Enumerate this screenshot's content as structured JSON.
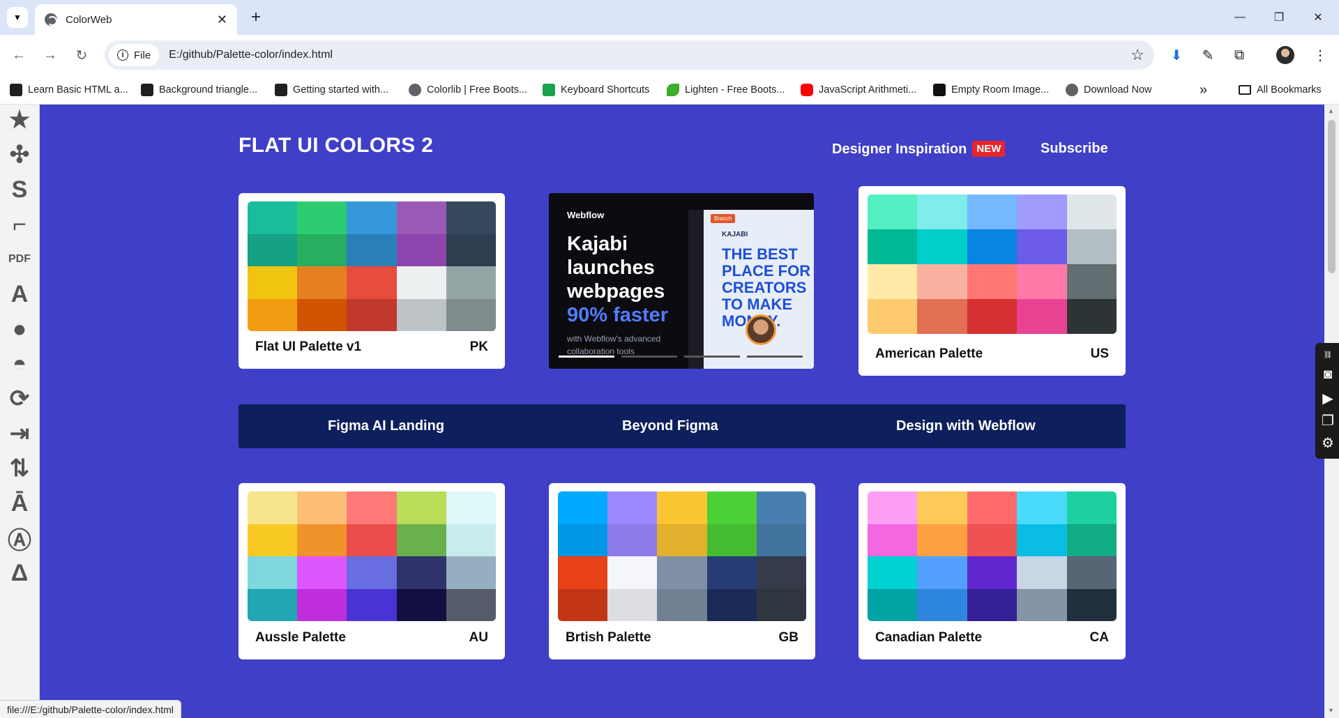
{
  "browser": {
    "tab_title": "ColorWeb",
    "tab_close": "✕",
    "new_tab": "+",
    "url_chip": "File",
    "url": "E:/github/Palette-color/index.html",
    "window_controls": {
      "minimize": "—",
      "restore": "❐",
      "close": "✕"
    }
  },
  "bookmarks": [
    {
      "label": "Learn Basic HTML a...",
      "icon": "code-icon",
      "color": "#1f1f1f"
    },
    {
      "label": "Background triangle...",
      "icon": "w-icon",
      "color": "#1f1f1f"
    },
    {
      "label": "Getting started with...",
      "icon": "m-icon",
      "color": "#1f1f1f"
    },
    {
      "label": "Colorlib | Free Boots...",
      "icon": "globe-icon",
      "color": "#5f6368"
    },
    {
      "label": "Keyboard Shortcuts",
      "icon": "w-check-icon",
      "color": "#17a34a"
    },
    {
      "label": "Lighten - Free Boots...",
      "icon": "leaf-icon",
      "color": "#3fae2a"
    },
    {
      "label": "JavaScript Arithmeti...",
      "icon": "youtube-icon",
      "color": "#ff0000"
    },
    {
      "label": "Empty Room Image...",
      "icon": "square-icon",
      "color": "#111111"
    },
    {
      "label": "Download Now",
      "icon": "globe-icon",
      "color": "#5f6368"
    }
  ],
  "bookmarks_more": "»",
  "all_bookmarks": "All Bookmarks",
  "page": {
    "background": "#3f3fc8",
    "brand": "FLAT UI COLORS 2",
    "nav": {
      "inspiration": "Designer Inspiration",
      "badge": "NEW",
      "subscribe": "Subscribe"
    },
    "strip": {
      "link1": "Figma AI Landing",
      "link2": "Beyond Figma",
      "link3": "Design with Webflow"
    },
    "ad": {
      "logo": "Webflow",
      "headline_1": "Kajabi launches webpages",
      "headline_2": "90% faster",
      "sub": "with Webflow's advanced collaboration tools",
      "panel_brand": "KAJABI",
      "panel_branch": "Branch",
      "panel_text": "THE BEST PLACE FOR CREATORS TO MAKE MONEY."
    },
    "palettes": [
      {
        "name": "Flat UI Palette v1",
        "code": "PK",
        "colors": [
          "#1abc9c",
          "#2ecc71",
          "#3498db",
          "#9b59b6",
          "#34495e",
          "#16a085",
          "#27ae60",
          "#2980b9",
          "#8e44ad",
          "#2c3e50",
          "#f1c40f",
          "#e67e22",
          "#e74c3c",
          "#ecf0f1",
          "#95a5a6",
          "#f39c12",
          "#d35400",
          "#c0392b",
          "#bdc3c7",
          "#7f8c8d"
        ]
      },
      {
        "name": "American Palette",
        "code": "US",
        "colors": [
          "#55efc4",
          "#81ecec",
          "#74b9ff",
          "#a29bfe",
          "#dfe6e9",
          "#00b894",
          "#00cec9",
          "#0984e3",
          "#6c5ce7",
          "#b2bec3",
          "#ffeaa7",
          "#fab1a0",
          "#ff7675",
          "#fd79a8",
          "#636e72",
          "#fdcb6e",
          "#e17055",
          "#d63031",
          "#e84393",
          "#2d3436"
        ]
      },
      {
        "name": "Aussle Palette",
        "code": "AU",
        "colors": [
          "#f6e58d",
          "#ffbe76",
          "#ff7979",
          "#badc58",
          "#dff9fb",
          "#f9ca24",
          "#f0932b",
          "#eb4d4b",
          "#6ab04c",
          "#c7ecee",
          "#7ed6df",
          "#e056fd",
          "#686de0",
          "#30336b",
          "#95afc0",
          "#22a6b3",
          "#be2edd",
          "#4834d4",
          "#130f40",
          "#535c68"
        ]
      },
      {
        "name": "Brtish Palette",
        "code": "GB",
        "colors": [
          "#00a8ff",
          "#9c88ff",
          "#fbc531",
          "#4cd137",
          "#487eb0",
          "#0097e6",
          "#8c7ae6",
          "#e1b12c",
          "#44bd32",
          "#40739e",
          "#e84118",
          "#f5f6fa",
          "#7f8fa6",
          "#273c75",
          "#353b48",
          "#c23616",
          "#dcdde1",
          "#718093",
          "#192a56",
          "#2f3640"
        ]
      },
      {
        "name": "Canadian Palette",
        "code": "CA",
        "colors": [
          "#ff9ff3",
          "#feca57",
          "#ff6b6b",
          "#48dbfb",
          "#1dd1a1",
          "#f368e0",
          "#ff9f43",
          "#ee5253",
          "#0abde3",
          "#10ac84",
          "#00d2d3",
          "#54a0ff",
          "#5f27cd",
          "#c8d6e5",
          "#576574",
          "#01a3a4",
          "#2e86de",
          "#341f97",
          "#8395a7",
          "#222f3e"
        ]
      }
    ]
  },
  "status_url": "file:///E:/github/Palette-color/index.html"
}
